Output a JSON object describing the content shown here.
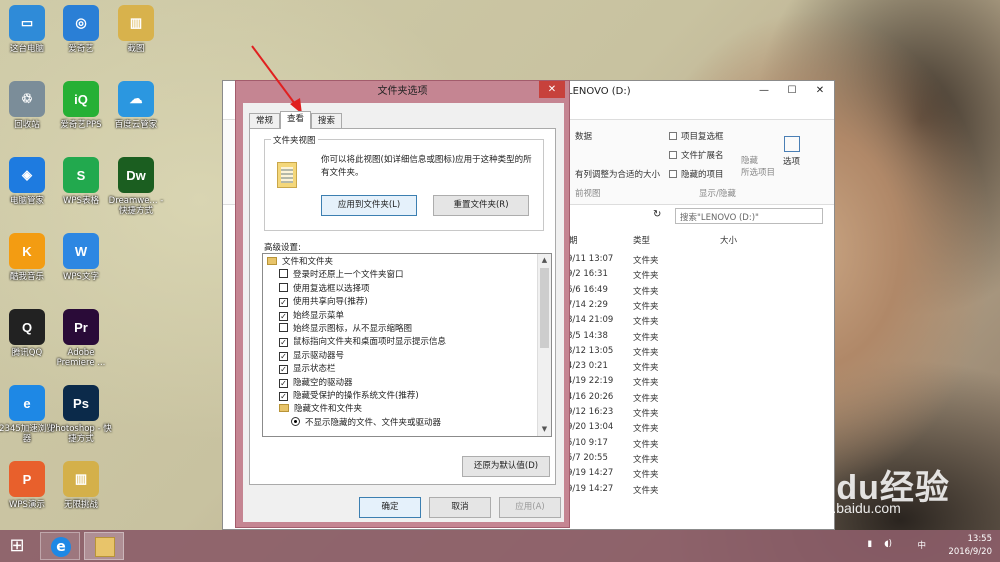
{
  "desktop_icons": [
    {
      "label": "这台电脑",
      "glyph": "▭",
      "color": "#2f8bd8"
    },
    {
      "label": "爱奇艺",
      "glyph": "◎",
      "color": "#2a7fd6"
    },
    {
      "label": "截图",
      "glyph": "▥",
      "color": "#d8b24c"
    },
    {
      "label": "回收站",
      "glyph": "♲",
      "color": "#7b8d99"
    },
    {
      "label": "爱奇艺PPS",
      "glyph": "iQ",
      "color": "#26b035"
    },
    {
      "label": "百度云管家",
      "glyph": "☁",
      "color": "#2b97e0"
    },
    {
      "label": "电脑管家",
      "glyph": "◈",
      "color": "#1e7be0"
    },
    {
      "label": "WPS表格",
      "glyph": "S",
      "color": "#22a94e"
    },
    {
      "label": "Dreamwe... - 快捷方式",
      "glyph": "Dw",
      "color": "#1b5e20"
    },
    {
      "label": "酷我音乐",
      "glyph": "K",
      "color": "#f39c12"
    },
    {
      "label": "WPS文字",
      "glyph": "W",
      "color": "#2d87e2"
    },
    {
      "label": "腾讯QQ",
      "glyph": "Q",
      "color": "#222"
    },
    {
      "label": "Adobe Premiere ...",
      "glyph": "Pr",
      "color": "#2a0b38"
    },
    {
      "label": "2345加速浏览器",
      "glyph": "e",
      "color": "#1e88e5"
    },
    {
      "label": "Photoshop - 快捷方式",
      "glyph": "Ps",
      "color": "#0b2a4a"
    },
    {
      "label": "WPS演示",
      "glyph": "P",
      "color": "#e8602c"
    },
    {
      "label": "无限挑战",
      "glyph": "▥",
      "color": "#d4b04a"
    }
  ],
  "explorer": {
    "title_suffix": "LENOVO (D:)",
    "ribbon": {
      "item_checkbox": "项目复选框",
      "file_ext": "文件扩展名",
      "hidden_items": "隐藏的项目",
      "hide": "隐藏",
      "hide_selected": "所选项目",
      "options": "选项",
      "show_hide": "显示/隐藏",
      "data_fragment": "数据",
      "fit_fragment": "有列调整为合适的大小",
      "view_fragment": "前视图"
    },
    "search_placeholder": "搜索\"LENOVO (D:)\"",
    "col_date_fragment": "期",
    "col_type": "类型",
    "col_size": "大小",
    "rows": [
      {
        "date": "9/11 13:07",
        "type": "文件夹"
      },
      {
        "date": "9/2 16:31",
        "type": "文件夹"
      },
      {
        "date": "6/6 16:49",
        "type": "文件夹"
      },
      {
        "date": "7/14 2:29",
        "type": "文件夹"
      },
      {
        "date": "8/14 21:09",
        "type": "文件夹"
      },
      {
        "date": "8/5 14:38",
        "type": "文件夹"
      },
      {
        "date": "3/12 13:05",
        "type": "文件夹"
      },
      {
        "date": "4/23 0:21",
        "type": "文件夹"
      },
      {
        "date": "4/19 22:19",
        "type": "文件夹"
      },
      {
        "date": "4/16 20:26",
        "type": "文件夹"
      },
      {
        "date": "9/12 16:23",
        "type": "文件夹"
      },
      {
        "date": "9/20 13:04",
        "type": "文件夹"
      },
      {
        "date": "5/10 9:17",
        "type": "文件夹"
      },
      {
        "date": "5/7 20:55",
        "type": "文件夹"
      },
      {
        "date": "9/19 14:27",
        "type": "文件夹"
      },
      {
        "date": "9/19 14:27",
        "type": "文件夹"
      }
    ]
  },
  "dialog": {
    "title": "文件夹选项",
    "close_glyph": "✕",
    "tabs": [
      "常规",
      "查看",
      "搜索"
    ],
    "active_tab": 1,
    "folder_view": {
      "group_title": "文件夹视图",
      "description": "你可以将此视图(如详细信息或图标)应用于这种类型的所有文件夹。",
      "apply_btn": "应用到文件夹(L)",
      "reset_btn": "重置文件夹(R)"
    },
    "advanced_label": "高级设置:",
    "tree": [
      {
        "kind": "folder",
        "label": "文件和文件夹",
        "indent": 0
      },
      {
        "kind": "check",
        "label": "登录时还原上一个文件夹窗口",
        "checked": false,
        "indent": 1
      },
      {
        "kind": "check",
        "label": "使用复选框以选择项",
        "checked": false,
        "indent": 1
      },
      {
        "kind": "check",
        "label": "使用共享向导(推荐)",
        "checked": true,
        "indent": 1
      },
      {
        "kind": "check",
        "label": "始终显示菜单",
        "checked": true,
        "indent": 1
      },
      {
        "kind": "check",
        "label": "始终显示图标，从不显示缩略图",
        "checked": false,
        "indent": 1
      },
      {
        "kind": "check",
        "label": "鼠标指向文件夹和桌面项时显示提示信息",
        "checked": true,
        "indent": 1
      },
      {
        "kind": "check",
        "label": "显示驱动器号",
        "checked": true,
        "indent": 1
      },
      {
        "kind": "check",
        "label": "显示状态栏",
        "checked": true,
        "indent": 1
      },
      {
        "kind": "check",
        "label": "隐藏空的驱动器",
        "checked": true,
        "indent": 1
      },
      {
        "kind": "check",
        "label": "隐藏受保护的操作系统文件(推荐)",
        "checked": true,
        "indent": 1
      },
      {
        "kind": "folder",
        "label": "隐藏文件和文件夹",
        "indent": 1
      },
      {
        "kind": "radio",
        "label": "不显示隐藏的文件、文件夹或驱动器",
        "indent": 2
      }
    ],
    "restore_btn": "还原为默认值(D)",
    "ok_btn": "确定",
    "cancel_btn": "取消",
    "apply_btn": "应用(A)"
  },
  "taskbar": {
    "start_glyph": "⊞",
    "ime": "中",
    "time": "13:55",
    "date": "2016/9/20"
  },
  "watermark": {
    "brand": "Bai du经验",
    "url": "jingyan.baidu.com"
  }
}
